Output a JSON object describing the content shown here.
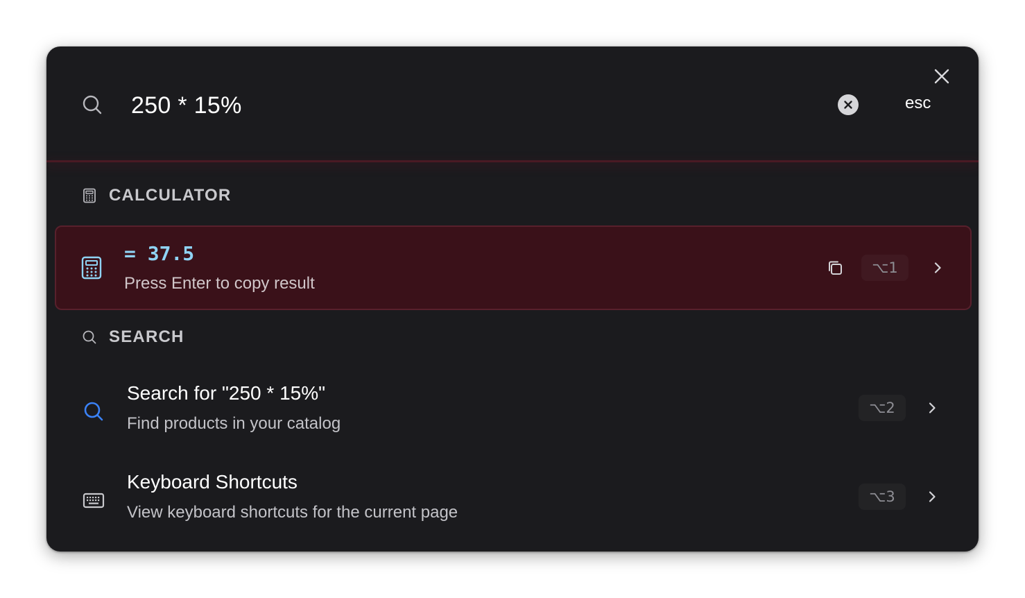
{
  "search": {
    "query": "250 * 15%",
    "esc_label": "esc"
  },
  "sections": {
    "calculator": "CALCULATOR",
    "search": "SEARCH"
  },
  "calculator_result": {
    "result": "= 37.5",
    "subtitle": "Press Enter to copy result",
    "shortcut": "⌥1"
  },
  "results": [
    {
      "title": "Search for \"250 * 15%\"",
      "subtitle": "Find products in your catalog",
      "shortcut": "⌥2",
      "icon": "search-icon"
    },
    {
      "title": "Keyboard Shortcuts",
      "subtitle": "View keyboard shortcuts for the current page",
      "shortcut": "⌥3",
      "icon": "keyboard-icon"
    }
  ],
  "colors": {
    "panel_bg": "#1b1b1e",
    "highlight_bg": "#3a1119",
    "result_accent": "#8fd3f4",
    "search_icon_accent": "#3b82f6"
  }
}
